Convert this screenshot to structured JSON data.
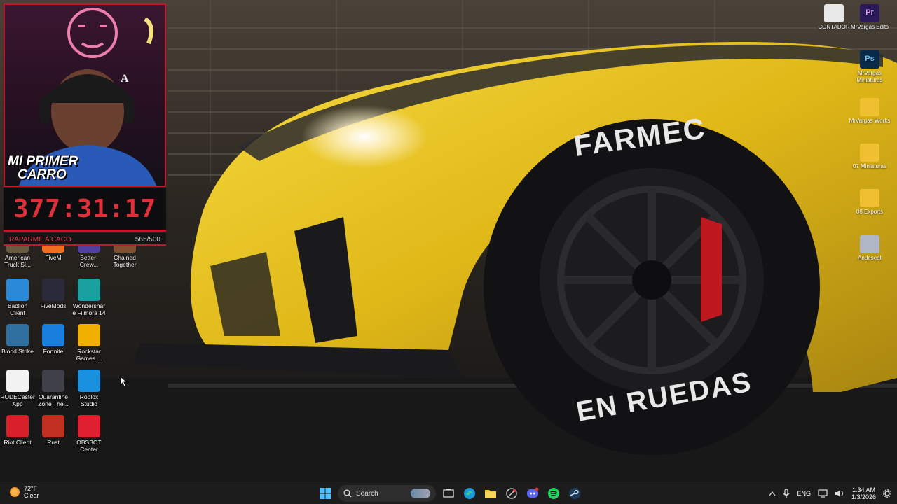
{
  "overlay": {
    "banner_line1": "MI PRIMER",
    "banner_line2": "CARRO",
    "timer": "377:31:17",
    "goal_label": "RAPARME A CACO",
    "goal_count": "565/500",
    "goal_progress": 1.0,
    "accent": "#c0182a"
  },
  "wallpaper": {
    "tire_top_text": "FARMEC",
    "tire_bottom_text": "EN RUEDAS",
    "car_color": "#e8c21e"
  },
  "desktop_left_icons": [
    {
      "label": "American Truck Si...",
      "icon": "truck-game-icon",
      "color": "#6a5a40"
    },
    {
      "label": "FiveM",
      "icon": "fivem-icon",
      "color": "#f07020"
    },
    {
      "label": "Better-Crew...",
      "icon": "crew-icon",
      "color": "#5040a0"
    },
    {
      "label": "Chained Together",
      "icon": "chain-icon",
      "color": "#805030"
    },
    {
      "label": "Badlion Client",
      "icon": "badlion-icon",
      "color": "#2a8ad8"
    },
    {
      "label": "FiveMods",
      "icon": "fivemods-icon",
      "color": "#2a2a3a"
    },
    {
      "label": "Wondershare Filmora 14",
      "icon": "filmora-icon",
      "color": "#1aa0a0"
    },
    {
      "label": "Blood Strike",
      "icon": "bloodstrike-icon",
      "color": "#3070a0"
    },
    {
      "label": "Fortnite",
      "icon": "fortnite-icon",
      "color": "#1a80e0"
    },
    {
      "label": "Rockstar Games ...",
      "icon": "rockstar-icon",
      "color": "#f0b000"
    },
    {
      "label": "RODECaster App",
      "icon": "rodecaster-icon",
      "color": "#f2f2f2"
    },
    {
      "label": "Quarantine Zone The...",
      "icon": "quarantine-icon",
      "color": "#404048"
    },
    {
      "label": "Roblox Studio",
      "icon": "roblox-icon",
      "color": "#1a90e0"
    },
    {
      "label": "Riot Client",
      "icon": "riot-icon",
      "color": "#d8202a"
    },
    {
      "label": "Rust",
      "icon": "rust-icon",
      "color": "#c03020"
    },
    {
      "label": "OBSBOT Center",
      "icon": "obsbot-icon",
      "color": "#e02030"
    }
  ],
  "desktop_right_icons": [
    {
      "label": "CONTADOR",
      "icon": "text-file-icon",
      "color": "#e8e8e8"
    },
    {
      "label": "MrVargas Edits",
      "icon": "premiere-icon",
      "color": "#2a1a5a",
      "glyph": "Pr"
    },
    {
      "label": "MrVargas Miniaturas",
      "icon": "photoshop-icon",
      "color": "#0a2a4a",
      "glyph": "Ps"
    },
    {
      "label": "MrVargas Works",
      "icon": "folder-icon",
      "color": "#f0c030"
    },
    {
      "label": "07 Miniaturas",
      "icon": "folder-image-icon",
      "color": "#f0c030"
    },
    {
      "label": "08 Exports",
      "icon": "folder-icon",
      "color": "#f0c030"
    },
    {
      "label": "Andeseat",
      "icon": "image-file-icon",
      "color": "#b0b8c8"
    }
  ],
  "taskbar": {
    "weather_temp": "72°F",
    "weather_desc": "Clear",
    "search_placeholder": "Search",
    "language": "ENG",
    "time": "1:34 AM",
    "date": "1/3/2026"
  }
}
